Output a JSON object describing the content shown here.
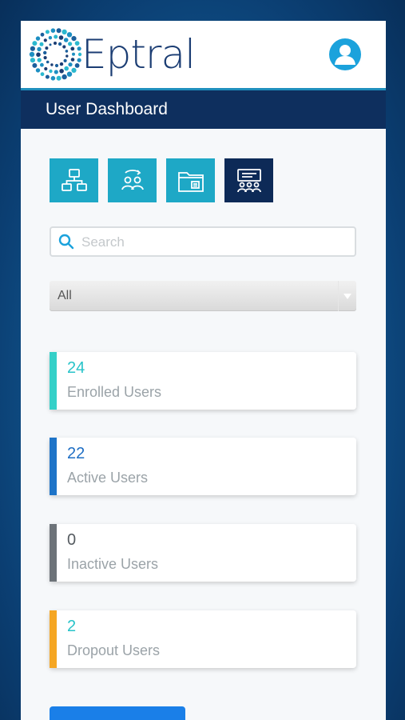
{
  "brand": {
    "name": "Eptral"
  },
  "header": {
    "title": "User Dashboard"
  },
  "nav_tiles": [
    {
      "icon": "org-chart-icon",
      "active": false
    },
    {
      "icon": "user-sync-icon",
      "active": false
    },
    {
      "icon": "folder-icon",
      "active": false
    },
    {
      "icon": "presentation-users-icon",
      "active": true
    }
  ],
  "search": {
    "placeholder": "Search",
    "value": ""
  },
  "filter": {
    "selected": "All"
  },
  "stats": [
    {
      "count": "24",
      "label": "Enrolled Users",
      "color": "#35d0c8",
      "count_color": "#27c3c9"
    },
    {
      "count": "22",
      "label": "Active Users",
      "color": "#1e74c8",
      "count_color": "#1e6ec4"
    },
    {
      "count": "0",
      "label": "Inactive Users",
      "color": "#6d7379",
      "count_color": "#555b60"
    },
    {
      "count": "2",
      "label": "Dropout Users",
      "color": "#f5a623",
      "count_color": "#27c3c9"
    }
  ],
  "colors": {
    "tile": "#1ea8c6",
    "tile_active": "#0d2a57",
    "titlebar": "#0e2f5e",
    "accent": "#1ba2dc"
  }
}
